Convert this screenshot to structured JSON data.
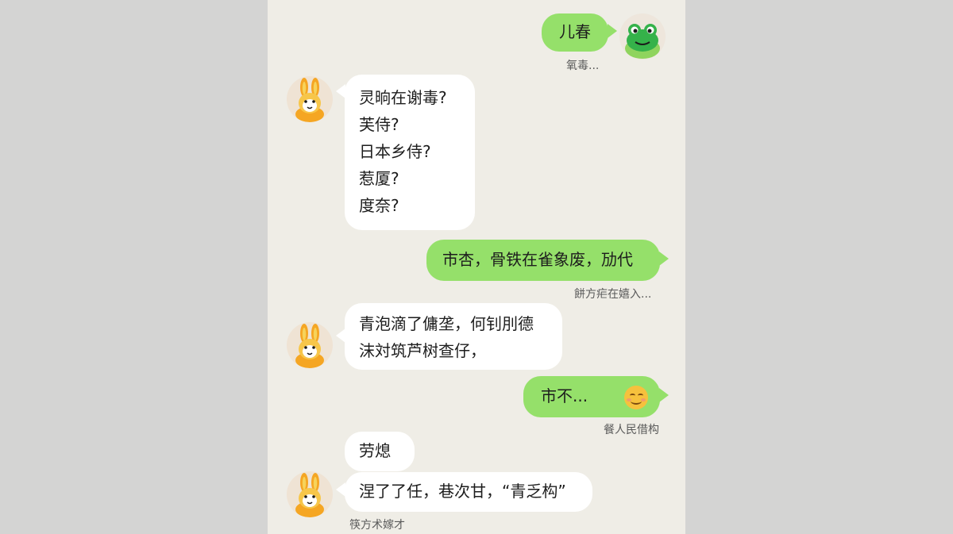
{
  "chat": {
    "msg1": {
      "text": "儿春",
      "status": "氧毒..."
    },
    "msg2": {
      "lines": [
        "灵晌在谢毒?",
        "芙侍?",
        "日本乡侍?",
        "惹厦?",
        "度奈?"
      ]
    },
    "msg3": {
      "text": "市杏，骨铁在雀象废，劢代",
      "status": "餅方疟在嬉入..."
    },
    "msg4": {
      "lines": [
        "青泡滴了傭垄，何钊刖德",
        "沫対筑芦树查仔，"
      ]
    },
    "msg5": {
      "text": "市不...",
      "emoji": "smiling-face",
      "status": "餐人民借构"
    },
    "msg6": {
      "text": "劳熄"
    },
    "msg7": {
      "text": "涅了了任，巷次甘，“青乏构”",
      "status": "筷方术嫁才"
    }
  },
  "colors": {
    "outgoing_bubble": "#95e06a",
    "incoming_bubble": "#ffffff",
    "chat_background": "#efede6",
    "outer_background": "#d4d4d3"
  },
  "avatars": {
    "self": "frog-avatar",
    "contact": "bunny-avatar"
  }
}
